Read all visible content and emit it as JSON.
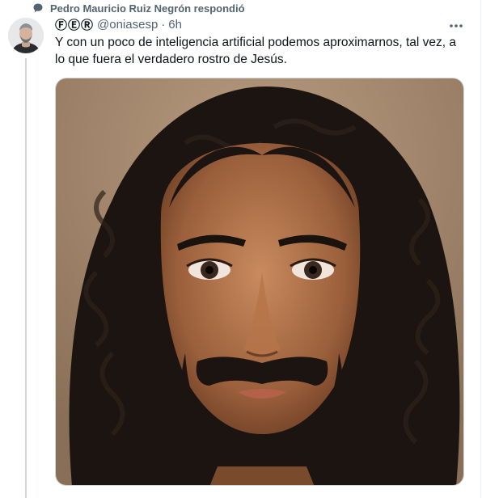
{
  "social_context": {
    "text": "Pedro Mauricio Ruiz Negrón respondió",
    "icon": "speech-bubble-icon"
  },
  "tweet": {
    "display_name": "ⒻⒺⓇ",
    "handle": "@oniasesp",
    "separator": "·",
    "time": "6h",
    "text": "Y con un poco de inteligencia artificial podemos aproximarnos, tal vez, a lo que fuera el verdadero rostro de Jesús.",
    "more_icon": "more-dots-icon",
    "media": "photo of a man's face with long dark curly hair and beard"
  },
  "colors": {
    "secondary_text": "#536471",
    "primary_text": "#0f1419",
    "thread_line": "#cfd9de"
  }
}
